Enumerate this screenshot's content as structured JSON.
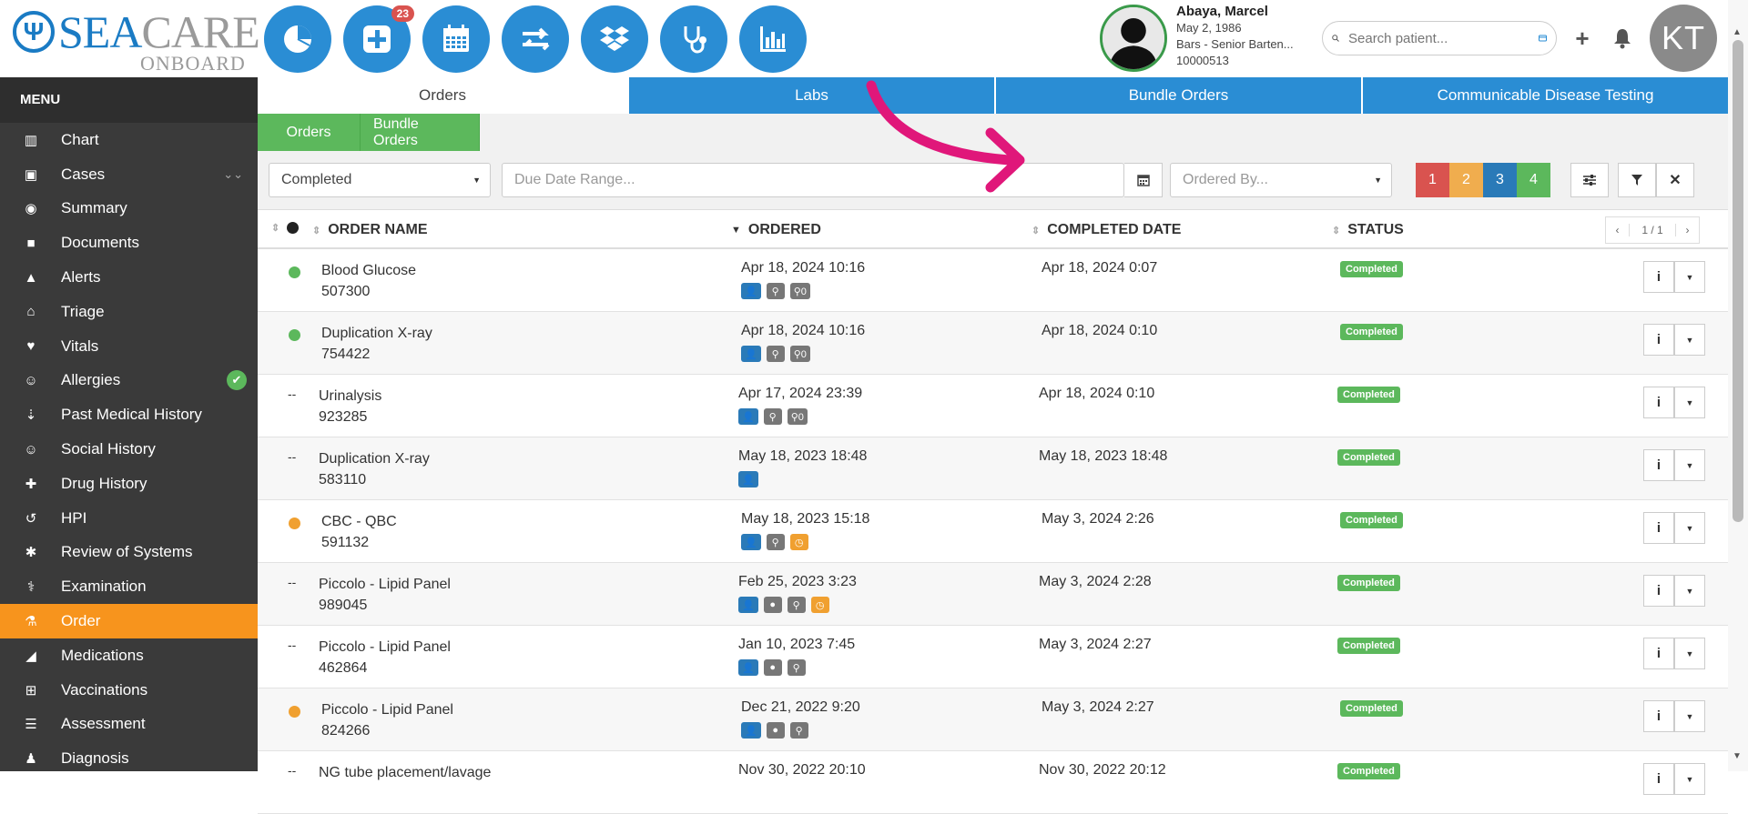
{
  "logo": {
    "sea": "SEA",
    "care": "CARE",
    "sub": "ONBOARD"
  },
  "nav_buttons": [
    {
      "icon": "pie-chart-icon"
    },
    {
      "icon": "plus-square-icon",
      "badge": "23"
    },
    {
      "icon": "calendar-icon"
    },
    {
      "icon": "exchange-icon"
    },
    {
      "icon": "dropbox-icon"
    },
    {
      "icon": "stethoscope-icon"
    },
    {
      "icon": "bar-chart-icon"
    }
  ],
  "patient": {
    "name": "Abaya, Marcel",
    "dob": "May 2, 1986",
    "role": "Bars - Senior Barten...",
    "id": "10000513"
  },
  "search": {
    "placeholder": "Search patient..."
  },
  "user_initials": "KT",
  "menu": {
    "title": "MENU",
    "items": [
      {
        "label": "Chart",
        "icon": "chart-icon"
      },
      {
        "label": "Cases",
        "icon": "cases-icon",
        "chevron": true
      },
      {
        "label": "Summary",
        "icon": "eye-icon"
      },
      {
        "label": "Documents",
        "icon": "folder-icon"
      },
      {
        "label": "Alerts",
        "icon": "warning-icon"
      },
      {
        "label": "Triage",
        "icon": "inbox-icon"
      },
      {
        "label": "Vitals",
        "icon": "heart-icon"
      },
      {
        "label": "Allergies",
        "icon": "smile-icon",
        "check": true
      },
      {
        "label": "Past Medical History",
        "icon": "sort-icon"
      },
      {
        "label": "Social History",
        "icon": "smile-icon"
      },
      {
        "label": "Drug History",
        "icon": "medkit-icon"
      },
      {
        "label": "HPI",
        "icon": "history-icon"
      },
      {
        "label": "Review of Systems",
        "icon": "gear-icon"
      },
      {
        "label": "Examination",
        "icon": "stethoscope-icon"
      },
      {
        "label": "Order",
        "icon": "flask-icon",
        "active": true
      },
      {
        "label": "Medications",
        "icon": "pill-icon"
      },
      {
        "label": "Vaccinations",
        "icon": "plus-square-icon"
      },
      {
        "label": "Assessment",
        "icon": "list-icon"
      },
      {
        "label": "Diagnosis",
        "icon": "user-md-icon"
      }
    ]
  },
  "tabs": [
    "Orders",
    "Labs",
    "Bundle Orders",
    "Communicable Disease Testing"
  ],
  "subtabs": [
    "Orders",
    "Bundle Orders"
  ],
  "filters": {
    "status": "Completed",
    "due_date_placeholder": "Due Date Range...",
    "ordered_by_placeholder": "Ordered By...",
    "priorities": [
      {
        "label": "1",
        "color": "#d9534f"
      },
      {
        "label": "2",
        "color": "#f0ad4e"
      },
      {
        "label": "3",
        "color": "#2a7ab8"
      },
      {
        "label": "4",
        "color": "#5cb85c"
      }
    ]
  },
  "table": {
    "headers": {
      "name": "ORDER NAME",
      "ordered": "ORDERED",
      "completed": "COMPLETED DATE",
      "status": "STATUS"
    },
    "pager": "1 / 1",
    "rows": [
      {
        "marker": "green",
        "name": "Blood Glucose",
        "code": "507300",
        "ordered": "Apr 18, 2024 10:16",
        "icons": [
          "user",
          "pin",
          "clip0"
        ],
        "completed": "Apr 18, 2024 0:07",
        "status": "Completed"
      },
      {
        "marker": "green",
        "name": "Duplication X-ray",
        "code": "754422",
        "ordered": "Apr 18, 2024 10:16",
        "icons": [
          "user",
          "pin",
          "clip0"
        ],
        "completed": "Apr 18, 2024 0:10",
        "status": "Completed"
      },
      {
        "marker": "dash",
        "name": "Urinalysis",
        "code": "923285",
        "ordered": "Apr 17, 2024 23:39",
        "icons": [
          "user",
          "pin",
          "clip0"
        ],
        "completed": "Apr 18, 2024 0:10",
        "status": "Completed"
      },
      {
        "marker": "dash",
        "name": "Duplication X-ray",
        "code": "583110",
        "ordered": "May 18, 2023 18:48",
        "icons": [
          "user"
        ],
        "completed": "May 18, 2023 18:48",
        "status": "Completed"
      },
      {
        "marker": "orange",
        "name": "CBC - QBC",
        "code": "591132",
        "ordered": "May 18, 2023 15:18",
        "icons": [
          "user",
          "pin",
          "clock"
        ],
        "completed": "May 3, 2024 2:26",
        "status": "Completed"
      },
      {
        "marker": "dash",
        "name": "Piccolo - Lipid Panel",
        "code": "989045",
        "ordered": "Feb 25, 2023 3:23",
        "icons": [
          "user",
          "comment",
          "pin",
          "clock"
        ],
        "completed": "May 3, 2024 2:28",
        "status": "Completed"
      },
      {
        "marker": "dash",
        "name": "Piccolo - Lipid Panel",
        "code": "462864",
        "ordered": "Jan 10, 2023 7:45",
        "icons": [
          "user",
          "comment",
          "pin"
        ],
        "completed": "May 3, 2024 2:27",
        "status": "Completed"
      },
      {
        "marker": "orange",
        "name": "Piccolo - Lipid Panel",
        "code": "824266",
        "ordered": "Dec 21, 2022 9:20",
        "icons": [
          "user",
          "comment",
          "pin"
        ],
        "completed": "May 3, 2024 2:27",
        "status": "Completed"
      },
      {
        "marker": "dash",
        "name": "NG tube placement/lavage",
        "code": "",
        "ordered": "Nov 30, 2022 20:10",
        "icons": [],
        "completed": "Nov 30, 2022 20:12",
        "status": "Completed"
      }
    ]
  },
  "colors": {
    "blue": "#2a8dd4",
    "green": "#5cb85c",
    "orange": "#f7941d",
    "annotation": "#e0177a"
  }
}
